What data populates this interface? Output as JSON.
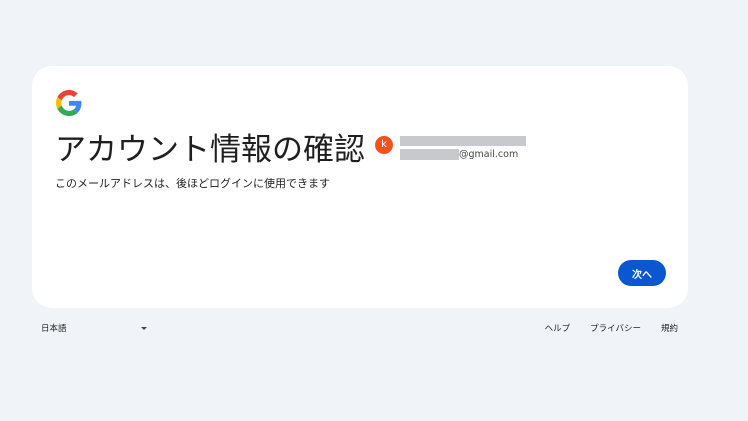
{
  "card": {
    "logo_icon": "google-g-logo",
    "title": "アカウント情報の確認",
    "subtitle": "このメールアドレスは、後ほどログインに使用できます"
  },
  "account": {
    "avatar_initial": "k",
    "avatar_color": "#f4511e",
    "email_visible": "@gmail.com"
  },
  "actions": {
    "next_label": "次へ",
    "accent_color": "#0b57d0"
  },
  "footer": {
    "language": "日本語",
    "links": [
      "ヘルプ",
      "プライバシー",
      "規約"
    ]
  }
}
